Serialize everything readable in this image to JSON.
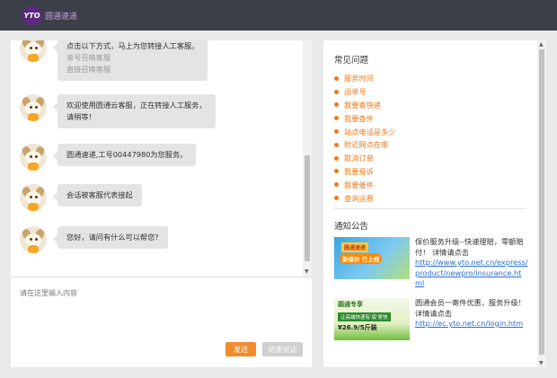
{
  "header": {
    "logo_mark": "YTO",
    "logo_text": "圆通速递"
  },
  "chat": {
    "messages": [
      {
        "lines": [
          "点击以下方式，马上为您转接人工客服。"
        ],
        "sub_lines": [
          "单号召唤客服",
          "直接召唤客服"
        ]
      },
      {
        "lines": [
          "欢迎使用圆通云客服，正在转接人工服务，",
          "请稍等！"
        ]
      },
      {
        "lines": [
          "圆通速递,工号00447980为您服务。"
        ]
      },
      {
        "lines": [
          "会话被客服代表接起"
        ]
      },
      {
        "lines": [
          "您好，请问有什么可以帮您?"
        ]
      }
    ],
    "input_placeholder": "请在这里输入内容",
    "send_label": "发送",
    "end_label": "结束对话"
  },
  "faq": {
    "title": "常见问题",
    "items": [
      "服务时间",
      "运单号",
      "我要寄快递",
      "我要查件",
      "站点电话是多少",
      "附近网点在哪",
      "取消订单",
      "我要投诉",
      "我要催件",
      "查询运费"
    ]
  },
  "notices": {
    "title": "通知公告",
    "items": [
      {
        "img_tag1": "圆通速递",
        "img_tag2": "新保价 已上线",
        "text": "保价服务升级--快速理赔，零额赔付！ 详情请点击",
        "link": "http://www.yto.net.cn/express/product/newpro/insurance.html"
      },
      {
        "img_tag1": "圆通专享",
        "img_tag2": "让高端快递有'底'更快",
        "img_tag3": "¥26.9/5斤装",
        "text": "圆通会员一寄件优惠，服务升级！详情请点击",
        "link": "http://ec.yto.net.cn/login.htm"
      }
    ]
  },
  "colors": {
    "topbar": "#3b4048",
    "accent": "#f07a1a",
    "send_button": "#f28b2c",
    "link": "#2a6fd1"
  }
}
